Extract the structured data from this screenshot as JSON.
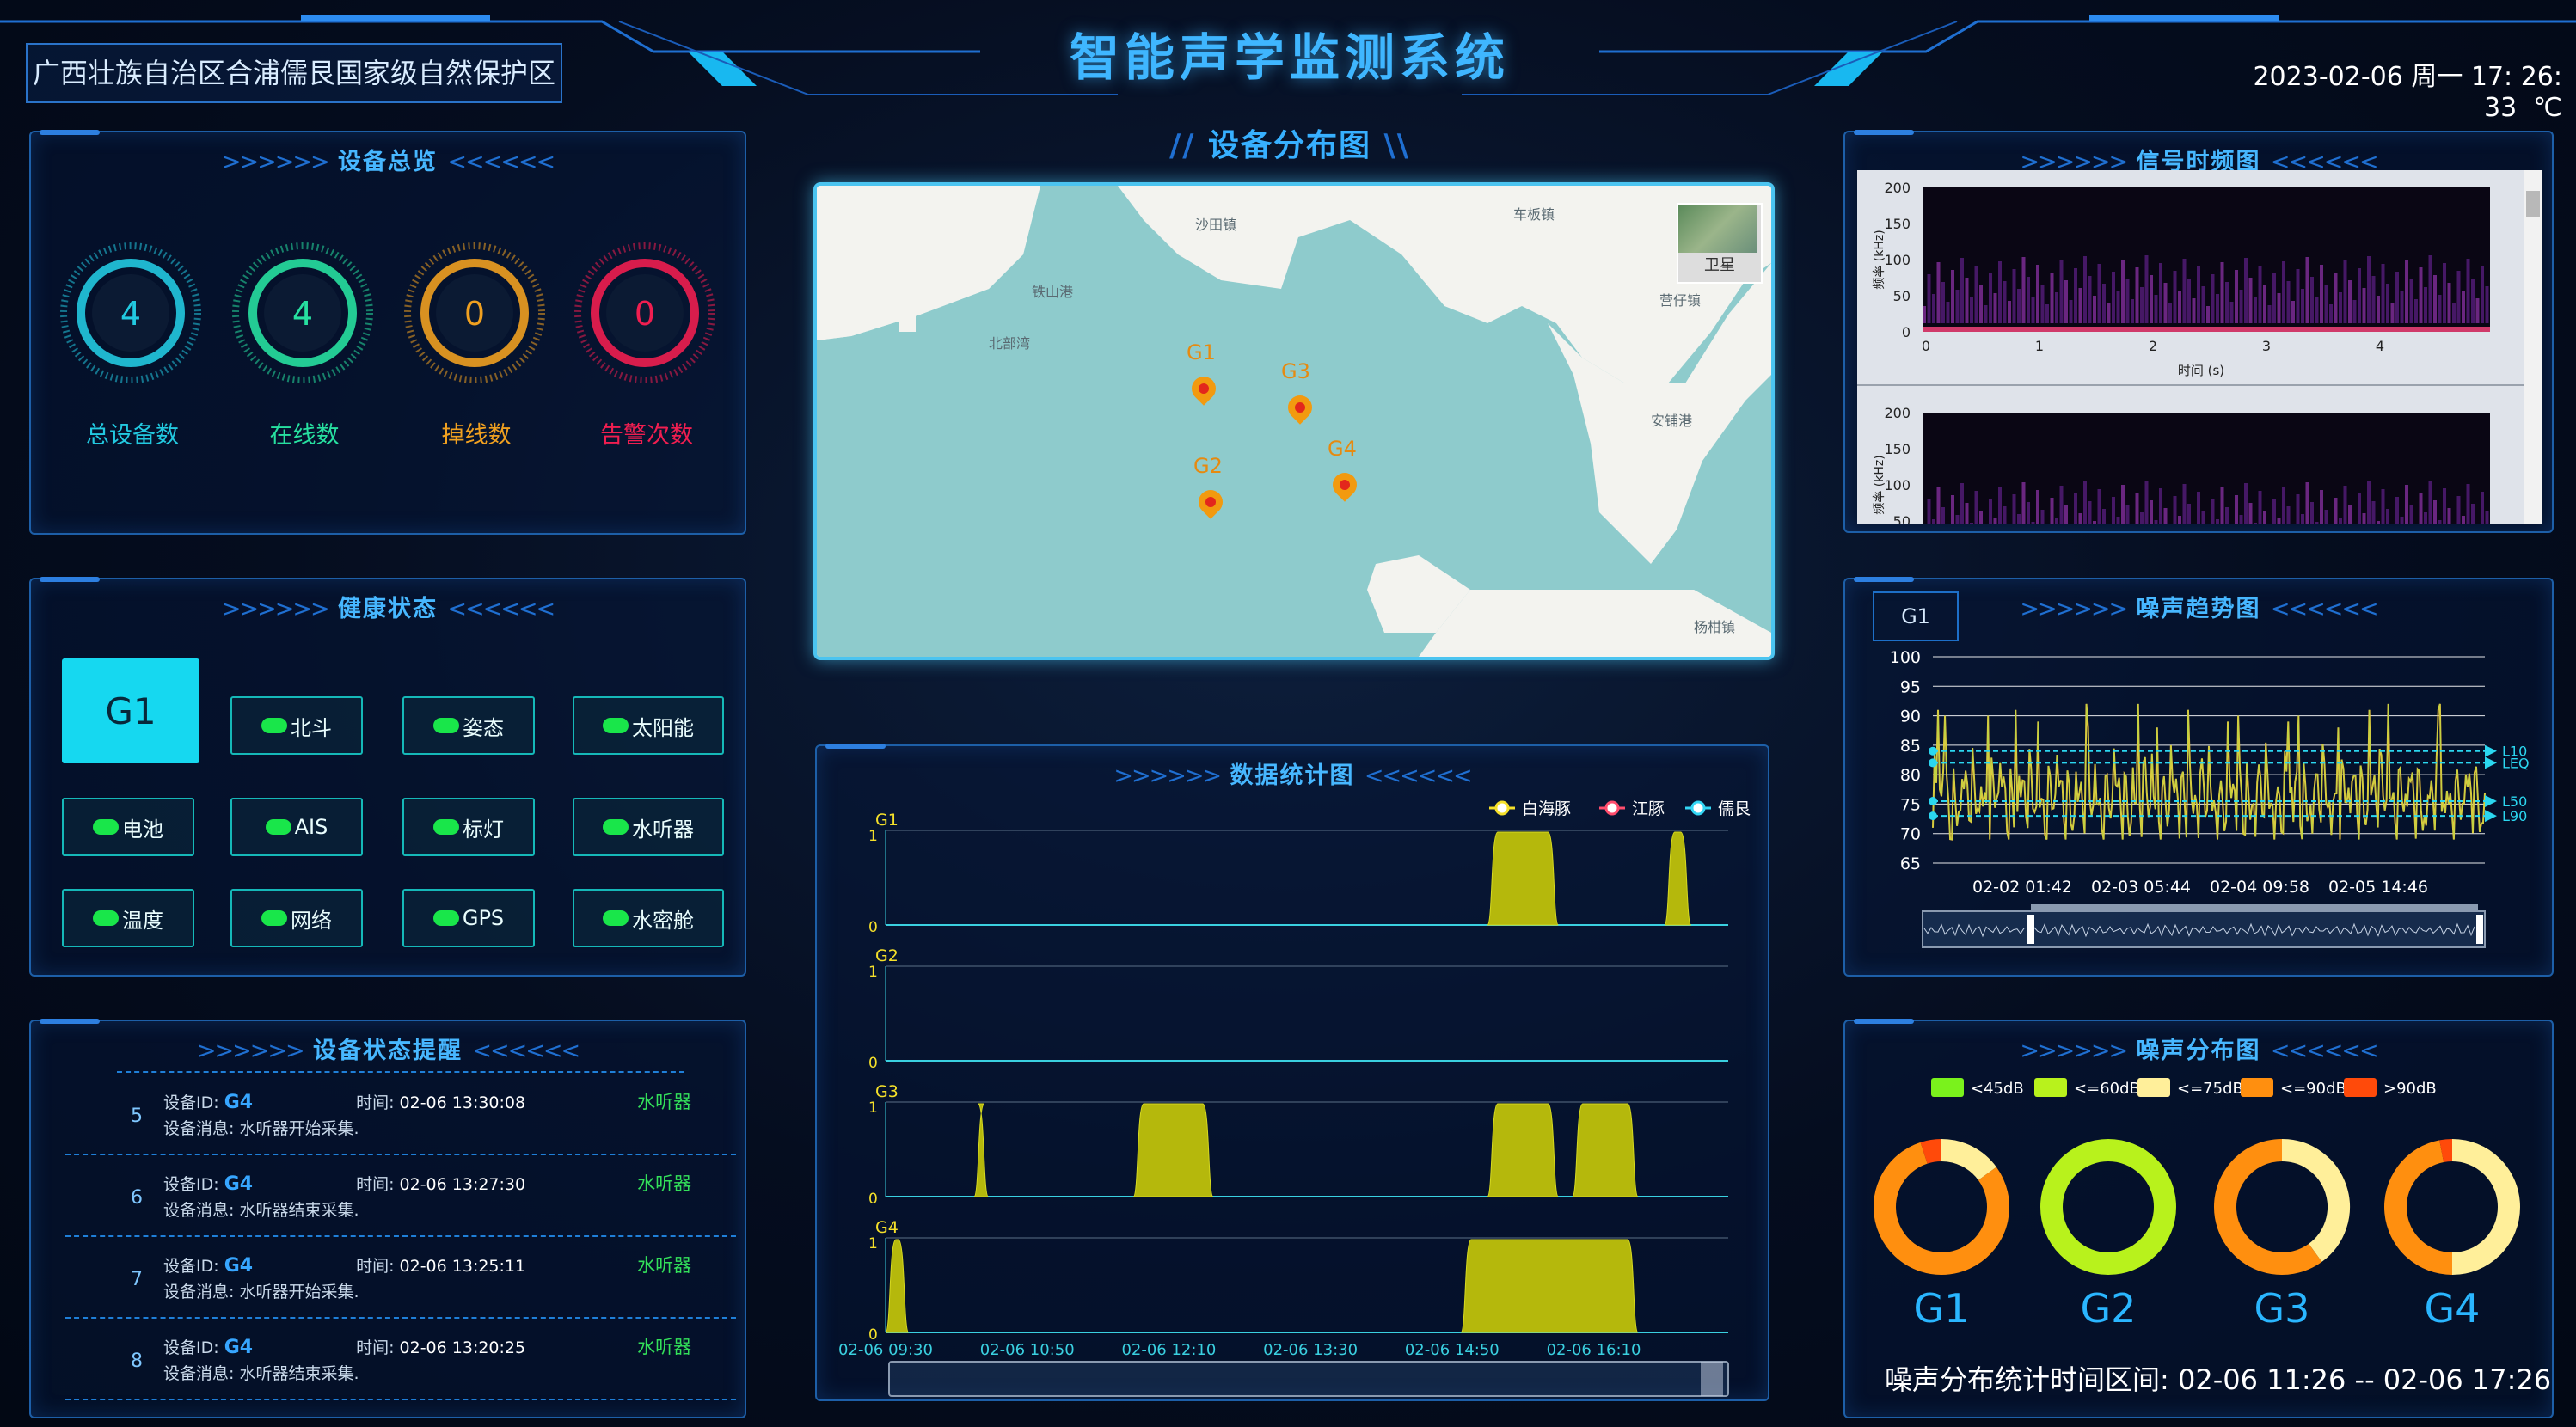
{
  "header": {
    "title": "智能声学监测系统",
    "location": "广西壮族自治区合浦儒艮国家级自然保护区",
    "datetime": "2023-02-06 周一 17: 26: 33",
    "unit": "℃"
  },
  "overview": {
    "title": "设备总览",
    "items": [
      {
        "value": "4",
        "label": "总设备数",
        "color": "#22c9e0"
      },
      {
        "value": "4",
        "label": "在线数",
        "color": "#27e0a0"
      },
      {
        "value": "0",
        "label": "掉线数",
        "color": "#f0a020"
      },
      {
        "value": "0",
        "label": "告警次数",
        "color": "#f01e50"
      }
    ]
  },
  "health": {
    "title": "健康状态",
    "selected": "G1",
    "items": [
      "北斗",
      "姿态",
      "太阳能",
      "电池",
      "AIS",
      "标灯",
      "水听器",
      "温度",
      "网络",
      "GPS",
      "水密舱"
    ]
  },
  "alerts": {
    "title": "设备状态提醒",
    "id_label": "设备ID:",
    "time_label": "时间:",
    "msg_label": "设备消息:",
    "rows": [
      {
        "num": "5",
        "id": "G4",
        "time": "02-06 13:30:08",
        "type": "水听器",
        "msg": "水听器开始采集."
      },
      {
        "num": "6",
        "id": "G4",
        "time": "02-06 13:27:30",
        "type": "水听器",
        "msg": "水听器结束采集."
      },
      {
        "num": "7",
        "id": "G4",
        "time": "02-06 13:25:11",
        "type": "水听器",
        "msg": "水听器开始采集."
      },
      {
        "num": "8",
        "id": "G4",
        "time": "02-06 13:20:25",
        "type": "水听器",
        "msg": "水听器结束采集."
      }
    ]
  },
  "map": {
    "title": "设备分布图",
    "satellite_label": "卫星",
    "places": [
      "沙田镇",
      "车板镇",
      "铁山港",
      "北部湾",
      "营仔镇",
      "安铺港",
      "杨柑镇"
    ],
    "pins": [
      "G1",
      "G2",
      "G3",
      "G4"
    ]
  },
  "stats": {
    "title": "数据统计图",
    "legend": [
      {
        "name": "白海豚",
        "color": "#f5e02a"
      },
      {
        "name": "江豚",
        "color": "#ff4d6d"
      },
      {
        "name": "儒艮",
        "color": "#33d6f5"
      }
    ],
    "x_ticks": [
      "02-06 09:30",
      "02-06 10:50",
      "02-06 12:10",
      "02-06 13:30",
      "02-06 14:50",
      "02-06 16:10"
    ],
    "y_ticks": [
      "0",
      "1"
    ]
  },
  "chart_data": [
    {
      "type": "area",
      "title": "数据统计图",
      "x_range": [
        "02-06 09:30",
        "02-06 17:26"
      ],
      "ylim": [
        0,
        1
      ],
      "series": [
        {
          "name": "G1",
          "segments": [
            [
              "02-06 15:10",
              "02-06 15:50"
            ],
            [
              "02-06 16:50",
              "02-06 17:05"
            ]
          ]
        },
        {
          "name": "G2",
          "segments": []
        },
        {
          "name": "G3",
          "segments": [
            [
              "02-06 10:20",
              "02-06 10:28"
            ],
            [
              "02-06 11:50",
              "02-06 12:35"
            ],
            [
              "02-06 15:10",
              "02-06 15:50"
            ],
            [
              "02-06 15:58",
              "02-06 16:35"
            ]
          ]
        },
        {
          "name": "G4",
          "segments": [
            [
              "02-06 09:30",
              "02-06 09:43"
            ],
            [
              "02-06 14:55",
              "02-06 16:35"
            ]
          ]
        }
      ]
    },
    {
      "type": "line",
      "title": "噪声趋势图",
      "device": "G1",
      "x_ticks": [
        "02-02 01:42",
        "02-03 05:44",
        "02-04 09:58",
        "02-05 14:46"
      ],
      "ylim": [
        65,
        100
      ],
      "y_ticks": [
        65,
        70,
        75,
        80,
        85,
        90,
        95,
        100
      ],
      "reference_lines": [
        {
          "name": "L10",
          "value": 84
        },
        {
          "name": "LEQ",
          "value": 82
        },
        {
          "name": "L50",
          "value": 75.5
        },
        {
          "name": "L90",
          "value": 73
        }
      ]
    },
    {
      "type": "pie",
      "title": "噪声分布图",
      "categories": [
        "<45dB",
        "<=60dB",
        "<=75dB",
        "<=90dB",
        ">90dB"
      ],
      "colors": [
        "#7af21c",
        "#b8f21c",
        "#ffef9a",
        "#ff8f0f",
        "#ff4a0a"
      ],
      "series": [
        {
          "name": "G1",
          "values": [
            0,
            0,
            15,
            80,
            5
          ]
        },
        {
          "name": "G2",
          "values": [
            0,
            100,
            0,
            0,
            0
          ]
        },
        {
          "name": "G3",
          "values": [
            0,
            0,
            40,
            60,
            0
          ]
        },
        {
          "name": "G4",
          "values": [
            0,
            0,
            50,
            47,
            3
          ]
        }
      ],
      "period_label": "噪声分布统计时间区间:",
      "period": "02-06 11:26 -- 02-06 17:26"
    }
  ],
  "spectrogram": {
    "title": "信号时频图",
    "ylabel": "频率 (kHz)",
    "xlabel": "时间 (s)",
    "y_ticks": [
      "200",
      "150",
      "100",
      "50",
      "0"
    ],
    "x_ticks": [
      "0",
      "1",
      "2",
      "3",
      "4"
    ]
  },
  "noise_trend": {
    "title": "噪声趋势图",
    "device": "G1"
  },
  "noise_dist": {
    "title": "噪声分布图",
    "period_label": "噪声分布统计时间区间:",
    "period": "02-06 11:26 -- 02-06 17:26"
  }
}
